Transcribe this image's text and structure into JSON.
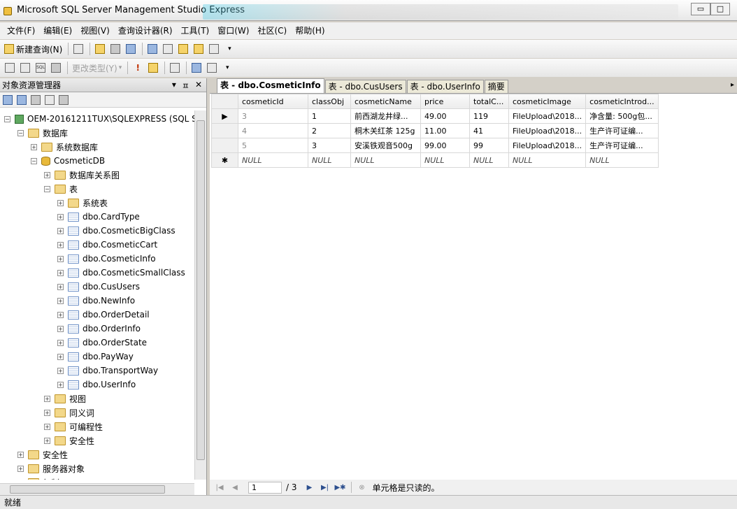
{
  "window": {
    "title": "Microsoft SQL Server Management Studio Express",
    "controls": [
      "▭",
      "□"
    ]
  },
  "menu": [
    "文件(F)",
    "编辑(E)",
    "视图(V)",
    "查询设计器(R)",
    "工具(T)",
    "窗口(W)",
    "社区(C)",
    "帮助(H)"
  ],
  "toolbar": {
    "new_query": "新建查询(N)",
    "change_type": "更改类型(Y)",
    "sql_label": "SQL"
  },
  "object_explorer": {
    "title": "对象资源管理器",
    "header_buttons": [
      "▾",
      "ㅍ",
      "✕"
    ],
    "tree": [
      {
        "label": "OEM-20161211TUX\\SQLEXPRESS (SQL S",
        "level": 0,
        "icon": "server-icon",
        "expanded": true
      },
      {
        "label": "数据库",
        "level": 1,
        "icon": "folder-icon",
        "expanded": true
      },
      {
        "label": "系统数据库",
        "level": 2,
        "icon": "folder-icon",
        "expanded": false
      },
      {
        "label": "CosmeticDB",
        "level": 2,
        "icon": "database-icon",
        "expanded": true
      },
      {
        "label": "数据库关系图",
        "level": 3,
        "icon": "folder-icon",
        "expanded": false
      },
      {
        "label": "表",
        "level": 3,
        "icon": "folder-icon",
        "expanded": true
      },
      {
        "label": "系统表",
        "level": 4,
        "icon": "folder-icon",
        "expanded": false
      },
      {
        "label": "dbo.CardType",
        "level": 4,
        "icon": "table-icon",
        "expanded": false
      },
      {
        "label": "dbo.CosmeticBigClass",
        "level": 4,
        "icon": "table-icon",
        "expanded": false
      },
      {
        "label": "dbo.CosmeticCart",
        "level": 4,
        "icon": "table-icon",
        "expanded": false
      },
      {
        "label": "dbo.CosmeticInfo",
        "level": 4,
        "icon": "table-icon",
        "expanded": false
      },
      {
        "label": "dbo.CosmeticSmallClass",
        "level": 4,
        "icon": "table-icon",
        "expanded": false
      },
      {
        "label": "dbo.CusUsers",
        "level": 4,
        "icon": "table-icon",
        "expanded": false
      },
      {
        "label": "dbo.NewInfo",
        "level": 4,
        "icon": "table-icon",
        "expanded": false
      },
      {
        "label": "dbo.OrderDetail",
        "level": 4,
        "icon": "table-icon",
        "expanded": false
      },
      {
        "label": "dbo.OrderInfo",
        "level": 4,
        "icon": "table-icon",
        "expanded": false
      },
      {
        "label": "dbo.OrderState",
        "level": 4,
        "icon": "table-icon",
        "expanded": false
      },
      {
        "label": "dbo.PayWay",
        "level": 4,
        "icon": "table-icon",
        "expanded": false
      },
      {
        "label": "dbo.TransportWay",
        "level": 4,
        "icon": "table-icon",
        "expanded": false
      },
      {
        "label": "dbo.UserInfo",
        "level": 4,
        "icon": "table-icon",
        "expanded": false
      },
      {
        "label": "视图",
        "level": 3,
        "icon": "folder-icon",
        "expanded": false
      },
      {
        "label": "同义词",
        "level": 3,
        "icon": "folder-icon",
        "expanded": false
      },
      {
        "label": "可编程性",
        "level": 3,
        "icon": "folder-icon",
        "expanded": false
      },
      {
        "label": "安全性",
        "level": 3,
        "icon": "folder-icon",
        "expanded": false
      },
      {
        "label": "安全性",
        "level": 1,
        "icon": "folder-icon",
        "expanded": false
      },
      {
        "label": "服务器对象",
        "level": 1,
        "icon": "folder-icon",
        "expanded": false
      },
      {
        "label": "复制",
        "level": 1,
        "icon": "folder-icon",
        "expanded": false
      }
    ]
  },
  "tabs": [
    {
      "label": "表 - dbo.CosmeticInfo",
      "active": true
    },
    {
      "label": "表 - dbo.CusUsers",
      "active": false
    },
    {
      "label": "表 - dbo.UserInfo",
      "active": false
    },
    {
      "label": "摘要",
      "active": false
    }
  ],
  "grid": {
    "columns": [
      "cosmeticId",
      "classObj",
      "cosmeticName",
      "price",
      "totalC...",
      "cosmeticImage",
      "cosmeticIntrod..."
    ],
    "rows": [
      {
        "marker": "▶",
        "cells": [
          "3",
          "1",
          "前西湖龙井绿...",
          "49.00",
          "119",
          "FileUpload\\2018...",
          "净含量: 500g包..."
        ]
      },
      {
        "marker": "",
        "cells": [
          "4",
          "2",
          "桐木关红茶 125g",
          "11.00",
          "41",
          "FileUpload\\2018...",
          "生产许可证编..."
        ]
      },
      {
        "marker": "",
        "cells": [
          "5",
          "3",
          "安溪铁观音500g",
          "99.00",
          "99",
          "FileUpload\\2018...",
          "生产许可证编..."
        ]
      },
      {
        "marker": "✱",
        "cells": [
          "NULL",
          "NULL",
          "NULL",
          "NULL",
          "NULL",
          "NULL",
          "NULL"
        ]
      }
    ]
  },
  "navigator": {
    "current_page": "1",
    "total": "/ 3",
    "status": "单元格是只读的。"
  },
  "statusbar": {
    "text": "就绪"
  }
}
